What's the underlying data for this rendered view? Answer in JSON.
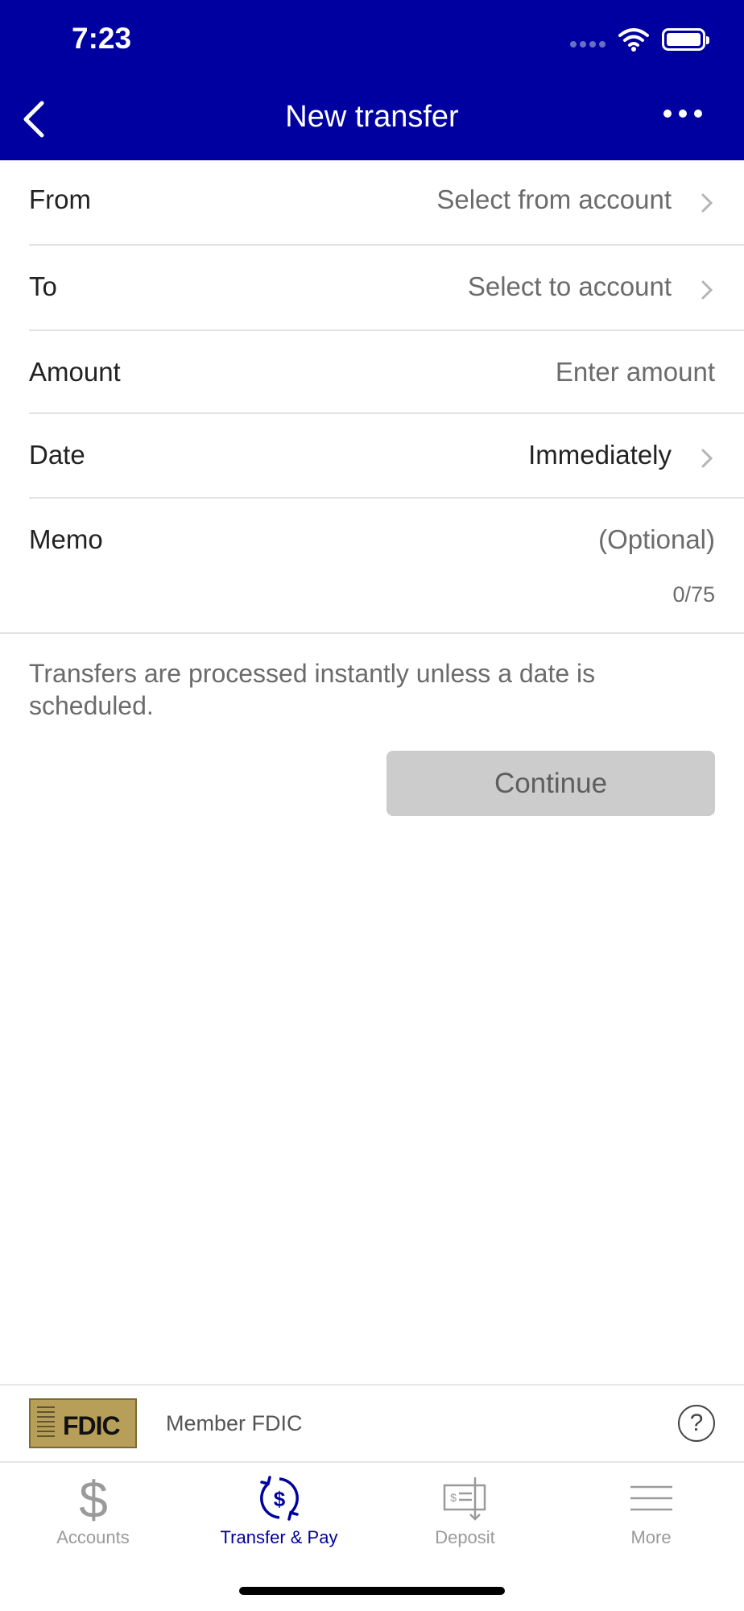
{
  "status_bar": {
    "time": "7:23"
  },
  "nav": {
    "title": "New transfer"
  },
  "form": {
    "from": {
      "label": "From",
      "value": "Select from account"
    },
    "to": {
      "label": "To",
      "value": "Select to account"
    },
    "amount": {
      "label": "Amount",
      "placeholder": "Enter amount"
    },
    "date": {
      "label": "Date",
      "value": "Immediately"
    },
    "memo": {
      "label": "Memo",
      "placeholder": "(Optional)",
      "counter": "0/75"
    }
  },
  "note": "Transfers are processed instantly unless a date is scheduled.",
  "continue_label": "Continue",
  "fdic": {
    "logo_text": "FDIC",
    "label": "Member FDIC",
    "help": "?"
  },
  "tabs": [
    {
      "label": "Accounts",
      "icon": "dollar-icon"
    },
    {
      "label": "Transfer & Pay",
      "icon": "transfer-pay-icon"
    },
    {
      "label": "Deposit",
      "icon": "check-deposit-icon"
    },
    {
      "label": "More",
      "icon": "hamburger-menu-icon"
    }
  ],
  "colors": {
    "brand": "#0000a0",
    "button_disabled": "#cccccc",
    "separator": "#e3e3e3"
  }
}
